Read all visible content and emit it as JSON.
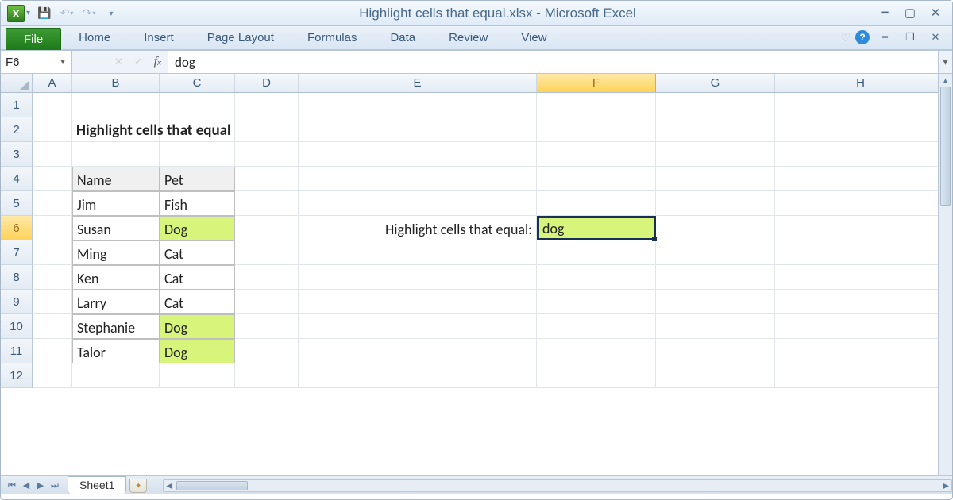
{
  "window": {
    "title": "Highlight cells that equal.xlsx - Microsoft Excel"
  },
  "ribbon": {
    "file": "File",
    "tabs": [
      "Home",
      "Insert",
      "Page Layout",
      "Formulas",
      "Data",
      "Review",
      "View"
    ]
  },
  "namebox": "F6",
  "formula": "dog",
  "columns": [
    "A",
    "B",
    "C",
    "D",
    "E",
    "F",
    "G",
    "H"
  ],
  "selected_col": "F",
  "selected_row": 6,
  "sheet": {
    "title": "Highlight cells that equal",
    "prompt": "Highlight cells that equal:",
    "criteria": "dog",
    "headers": {
      "name": "Name",
      "pet": "Pet"
    },
    "rows": [
      {
        "name": "Jim",
        "pet": "Fish",
        "hl": false
      },
      {
        "name": "Susan",
        "pet": "Dog",
        "hl": true
      },
      {
        "name": "Ming",
        "pet": "Cat",
        "hl": false
      },
      {
        "name": "Ken",
        "pet": "Cat",
        "hl": false
      },
      {
        "name": "Larry",
        "pet": "Cat",
        "hl": false
      },
      {
        "name": "Stephanie",
        "pet": "Dog",
        "hl": true
      },
      {
        "name": "Talor",
        "pet": "Dog",
        "hl": true
      }
    ]
  },
  "sheet_tab": "Sheet1"
}
